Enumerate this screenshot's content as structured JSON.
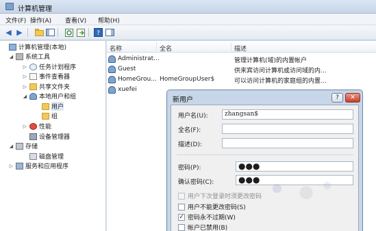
{
  "window": {
    "title": "计算机管理"
  },
  "menu": [
    {
      "label": "文件(F)"
    },
    {
      "label": "操作(A)"
    },
    {
      "label": "查看(V)"
    },
    {
      "label": "帮助(H)"
    }
  ],
  "toolbar": {
    "buttons": [
      "back-icon",
      "forward-icon",
      "up-folder-icon",
      "show-hide-tree-icon",
      "refresh-icon",
      "export-list-icon",
      "help-icon",
      "show-action-pane-icon"
    ]
  },
  "tree": {
    "items": [
      {
        "label": "计算机管理(本地)",
        "icon": "computer-icon",
        "expander": ""
      },
      {
        "label": "系统工具",
        "icon": "tools-icon",
        "expander": "◢"
      },
      {
        "label": "任务计划程序",
        "icon": "clock-icon",
        "expander": "▷"
      },
      {
        "label": "事件查看器",
        "icon": "log-icon",
        "expander": "▷"
      },
      {
        "label": "共享文件夹",
        "icon": "folder-icon",
        "expander": "▷"
      },
      {
        "label": "本地用户和组",
        "icon": "users-icon",
        "expander": "◢"
      },
      {
        "label": "用户",
        "icon": "folder-icon",
        "expander": ""
      },
      {
        "label": "组",
        "icon": "folder-icon",
        "expander": ""
      },
      {
        "label": "性能",
        "icon": "performance-icon",
        "expander": "▷"
      },
      {
        "label": "设备管理器",
        "icon": "device-icon",
        "expander": ""
      },
      {
        "label": "存储",
        "icon": "storage-icon",
        "expander": "◢"
      },
      {
        "label": "磁盘管理",
        "icon": "disk-icon",
        "expander": ""
      },
      {
        "label": "服务和应用程序",
        "icon": "services-icon",
        "expander": "▷"
      }
    ]
  },
  "list": {
    "columns": {
      "name": "名称",
      "full_name": "全名",
      "description": "描述"
    },
    "rows": [
      {
        "name": "Administrat...",
        "full_name": "",
        "description": "管理计算机(域)的内置帐户"
      },
      {
        "name": "Guest",
        "full_name": "",
        "description": "供来宾访问计算机或访问域的内..."
      },
      {
        "name": "HomeGrou...",
        "full_name": "HomeGroupUser$",
        "description": "可以访问计算机的家庭组的内置..."
      },
      {
        "name": "xuefei",
        "full_name": "",
        "description": ""
      }
    ]
  },
  "dialog": {
    "title": "新用户",
    "help_label": "?",
    "close_label": "✕",
    "username_label": "用户名(U):",
    "username_value": "zhangsan$",
    "fullname_label": "全名(F):",
    "fullname_value": "",
    "description_label": "描述(D):",
    "description_value": "",
    "password_label": "密码(P):",
    "password_value": "●●●",
    "confirm_label": "确认密码(C):",
    "confirm_value": "●●●",
    "checkboxes": [
      {
        "label": "用户下次登录时须更改密码",
        "checked": false,
        "disabled": true
      },
      {
        "label": "用户不能更改密码(S)",
        "checked": false,
        "disabled": false
      },
      {
        "label": "密码永不过期(W)",
        "checked": true,
        "disabled": false
      },
      {
        "label": "帐户已禁用(B)",
        "checked": false,
        "disabled": false
      }
    ]
  }
}
